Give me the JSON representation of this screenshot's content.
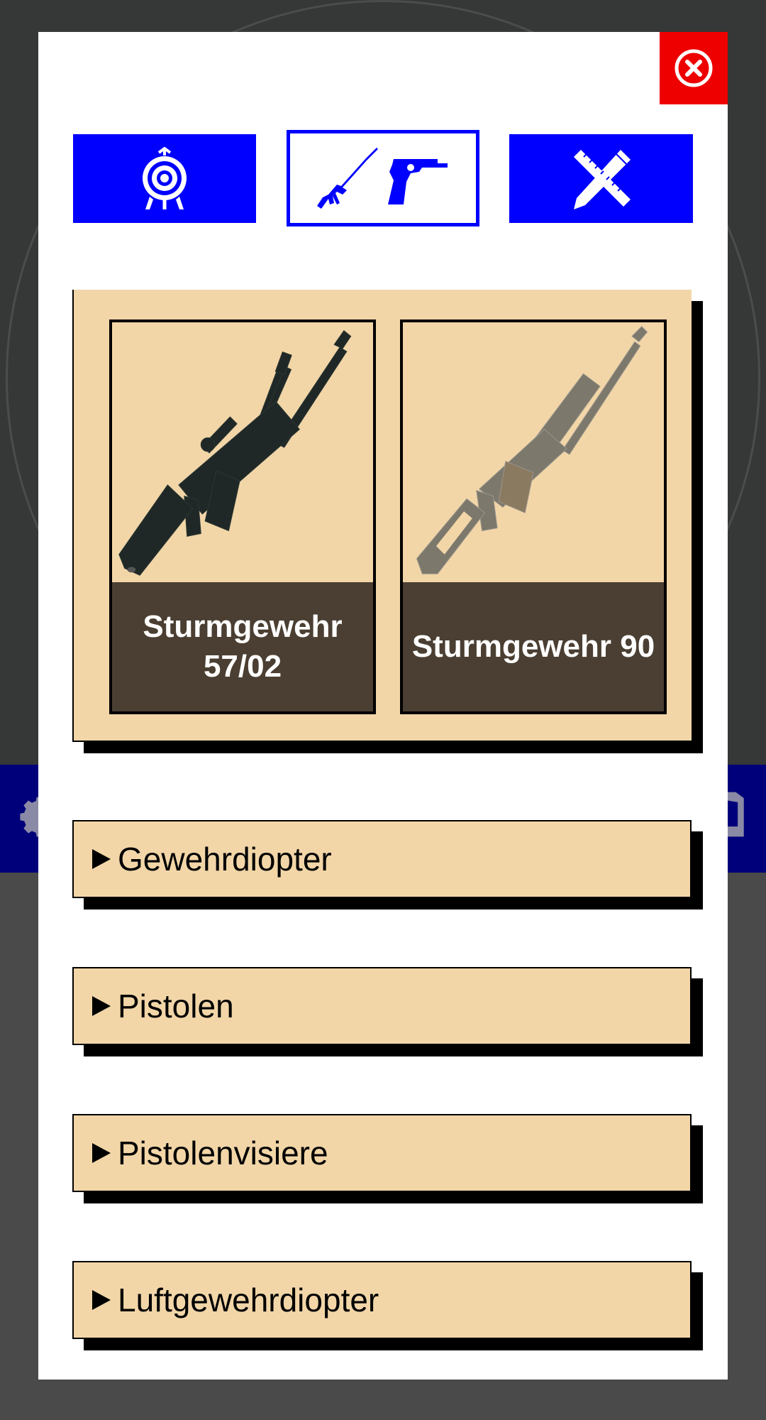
{
  "modal": {
    "close_icon": "close-circle-icon",
    "tabs": [
      {
        "name": "target",
        "icon": "target-icon",
        "selected": false
      },
      {
        "name": "weapons",
        "icon": "rifle-pistol-icon",
        "selected": true
      },
      {
        "name": "tools",
        "icon": "pencil-ruler-icon",
        "selected": false
      }
    ],
    "category": {
      "weapons": [
        {
          "label": "Sturmgewehr 57/02",
          "icon": "rifle-stgw57-image"
        },
        {
          "label": "Sturmgewehr 90",
          "icon": "rifle-stgw90-image"
        }
      ]
    },
    "sections": [
      {
        "label": "Gewehrdiopter"
      },
      {
        "label": "Pistolen"
      },
      {
        "label": "Pistolenvisiere"
      },
      {
        "label": "Luftgewehrdiopter"
      }
    ]
  },
  "colors": {
    "accent_blue": "#0000ff",
    "close_red": "#ee0000",
    "card_beige": "#f2d6a8",
    "label_brown": "#4a3f32",
    "overlay_dark": "#353836",
    "bar_navy": "#00007a"
  }
}
